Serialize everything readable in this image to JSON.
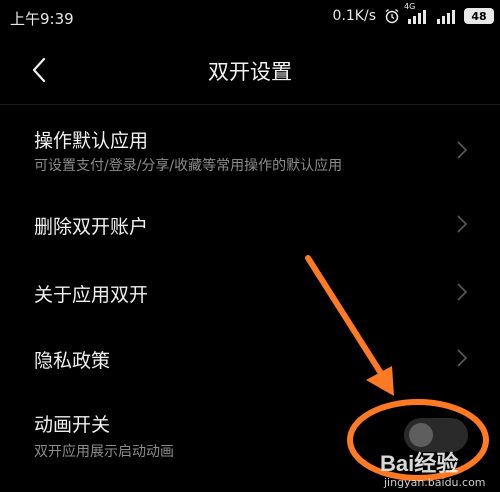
{
  "status_bar": {
    "time": "上午9:39",
    "net_speed": "0.1K/s",
    "network_type": "4G",
    "battery": "48",
    "icons": [
      "alarm-icon",
      "signal-icon",
      "signal-icon"
    ]
  },
  "header": {
    "title": "双开设置",
    "back_icon": "chevron-left-icon"
  },
  "settings": {
    "items": [
      {
        "title": "操作默认应用",
        "subtitle": "可设置支付/登录/分享/收藏等常用操作的默认应用",
        "control": "chevron"
      },
      {
        "title": "删除双开账户",
        "control": "chevron"
      },
      {
        "title": "关于应用双开",
        "control": "chevron"
      },
      {
        "title": "隐私政策",
        "control": "chevron"
      },
      {
        "title": "动画开关",
        "subtitle": "双开应用展示启动动画",
        "control": "toggle",
        "toggle_on": false
      }
    ]
  },
  "annotation": {
    "color": "#ff7a22",
    "shapes": [
      "arrow",
      "ellipse"
    ]
  },
  "watermark": {
    "brand": "Bai经验",
    "url": "jingyan.baidu.com"
  }
}
